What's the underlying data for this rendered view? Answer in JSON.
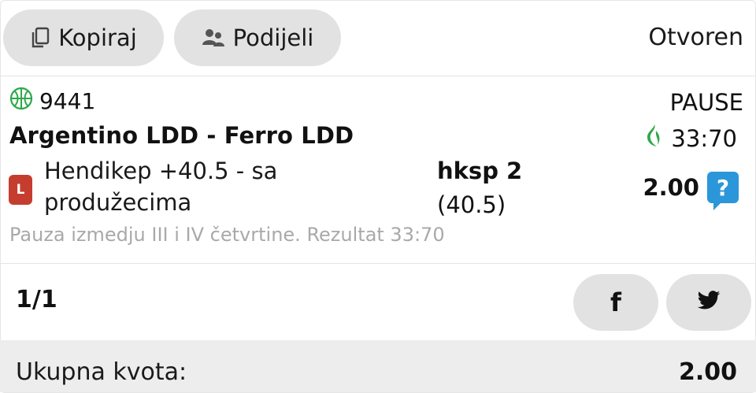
{
  "header": {
    "copy_label": "Kopiraj",
    "share_label": "Podijeli",
    "status": "Otvoren"
  },
  "event": {
    "sport_icon": "basketball-icon",
    "code": "9441",
    "teams": "Argentino LDD - Ferro LDD",
    "live_badge": "L",
    "market": "Hendikep +40.5 - sa produžecima",
    "pick_code": "hksp 2",
    "pick_line": "(40.5)",
    "comment": "Pauza izmedju III i IV četvrtine. Rezultat 33:70",
    "live_status": "PAUSE",
    "live_score": "33:70",
    "odds": "2.00",
    "help_symbol": "?"
  },
  "pager": {
    "count": "1/1"
  },
  "social": {
    "facebook": "f"
  },
  "footer": {
    "total_label": "Ukupna kvota:",
    "total_value": "2.00"
  },
  "colors": {
    "button_bg": "#e2e2e2",
    "live_badge": "#c43d2f",
    "help_icon": "#2b96d9",
    "live_flame": "#2ea84a",
    "basketball": "#2ea84a",
    "footer_bg": "#ededed"
  }
}
